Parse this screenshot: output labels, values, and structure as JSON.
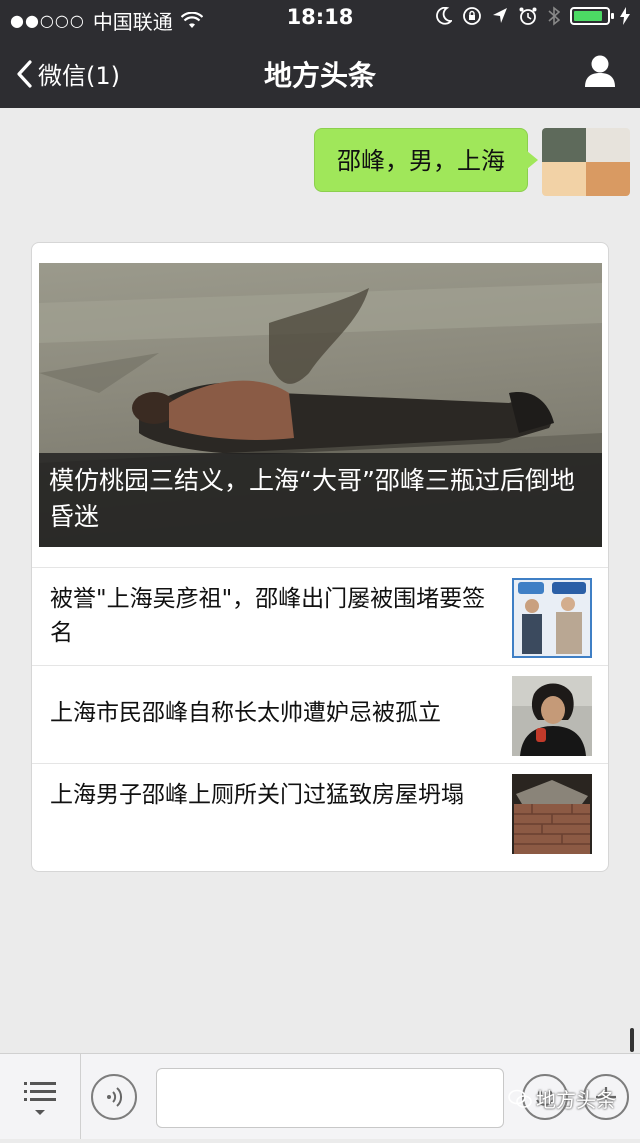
{
  "status_bar": {
    "signal": "●●○○○",
    "carrier": "中国联通",
    "time": "18:18",
    "battery_level": 0.9,
    "battery_color": "#4cd964"
  },
  "nav": {
    "back_label": "微信(1)",
    "title": "地方头条",
    "profile_icon": "person-icon"
  },
  "chat": {
    "outgoing_message": "邵峰，男，上海",
    "bubble_color": "#a0e75a"
  },
  "news_card": {
    "hero_title": "模仿桃园三结义，上海“大哥”邵峰三瓶过后倒地昏迷",
    "items": [
      {
        "title": "被誉\"上海吴彦祖\"，邵峰出门屡被围堵要签名"
      },
      {
        "title": "上海市民邵峰自称长太帅遭妒忌被孤立"
      },
      {
        "title": "上海男子邵峰上厕所关门过猛致房屋坍塌"
      }
    ]
  },
  "input_bar": {
    "input_value": "",
    "watermark": "地方头条"
  }
}
